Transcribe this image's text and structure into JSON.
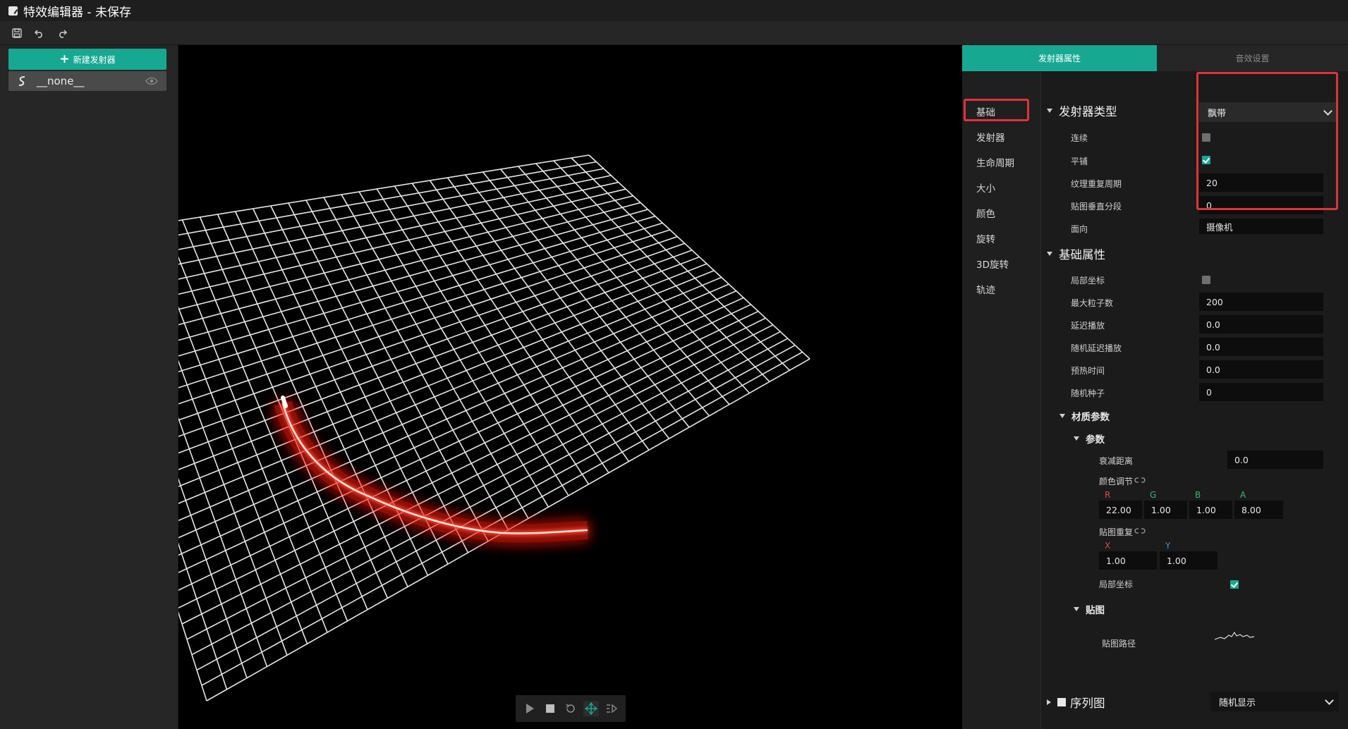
{
  "window": {
    "title": "特效编辑器 - 未保存"
  },
  "toolbar": {
    "save_icon": "save-icon",
    "undo_icon": "undo-icon",
    "redo_icon": "redo-icon"
  },
  "left": {
    "new_emitter_label": "新建发射器",
    "emitters": [
      {
        "name": "__none__"
      }
    ]
  },
  "tabs": [
    {
      "label": "发射器属性",
      "active": true
    },
    {
      "label": "音效设置",
      "active": false
    }
  ],
  "categories": [
    "基础",
    "发射器",
    "生命周期",
    "大小",
    "颜色",
    "旋转",
    "3D旋转",
    "轨迹"
  ],
  "emitter_type": {
    "title": "发射器类型",
    "value": "飘带",
    "continuous_label": "连续",
    "continuous": false,
    "tile_label": "平铺",
    "tile": true,
    "texture_repeat_label": "纹理重复周期",
    "texture_repeat": "20",
    "vertical_segments_label": "贴图垂直分段",
    "vertical_segments": "0",
    "facing_label": "面向",
    "facing": "摄像机"
  },
  "base": {
    "title": "基础属性",
    "local_coords_label": "局部坐标",
    "local_coords": false,
    "max_particles_label": "最大粒子数",
    "max_particles": "200",
    "delay_label": "延迟播放",
    "delay": "0.0",
    "random_delay_label": "随机延迟播放",
    "random_delay": "0.0",
    "prewarm_label": "预热时间",
    "prewarm": "0.0",
    "seed_label": "随机种子",
    "seed": "0",
    "material": {
      "title": "材质参数",
      "params": {
        "title": "参数",
        "falloff_label": "衰减距离",
        "falloff": "0.0",
        "color_adjust_label": "颜色调节",
        "r_label": "R",
        "r": "22.00",
        "g_label": "G",
        "g": "1.00",
        "b_label": "B",
        "b": "1.00",
        "a_label": "A",
        "a": "8.00",
        "tex_repeat_label": "贴图重复",
        "x_label": "X",
        "x": "1.00",
        "y_label": "Y",
        "y": "1.00",
        "local_coords_label": "局部坐标",
        "local_coords": true
      },
      "texture": {
        "title": "贴图",
        "path_label": "贴图路径"
      }
    }
  },
  "sequence": {
    "title": "序列图",
    "value": "随机显示"
  },
  "colors": {
    "accent": "#17a892",
    "highlight": "#e0323c",
    "grid": "#e6e6e6",
    "glow": "#ff2a1a"
  }
}
